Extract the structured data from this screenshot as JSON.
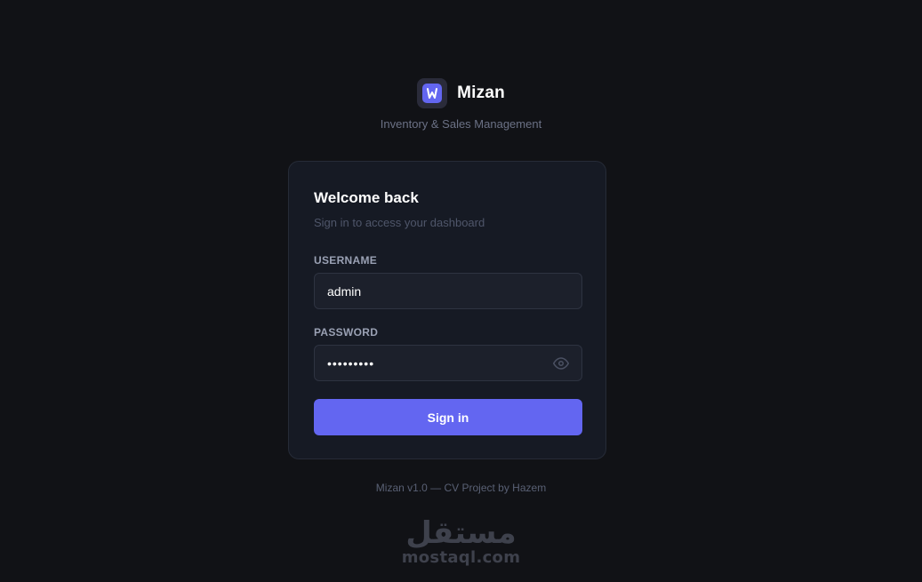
{
  "brand": {
    "name": "Mizan",
    "tagline": "Inventory & Sales Management",
    "logo_icon": "w-logo-icon",
    "accent_color": "#6366f1"
  },
  "login": {
    "title": "Welcome back",
    "subtitle": "Sign in to access your dashboard",
    "username_label": "USERNAME",
    "username_value": "admin",
    "password_label": "PASSWORD",
    "password_value": "password1",
    "password_toggle_icon": "eye-icon",
    "submit_label": "Sign in"
  },
  "footer": {
    "text": "Mizan v1.0 — CV Project by Hazem"
  },
  "watermark": {
    "arabic": "مستقل",
    "latin": "mostaql.com"
  }
}
